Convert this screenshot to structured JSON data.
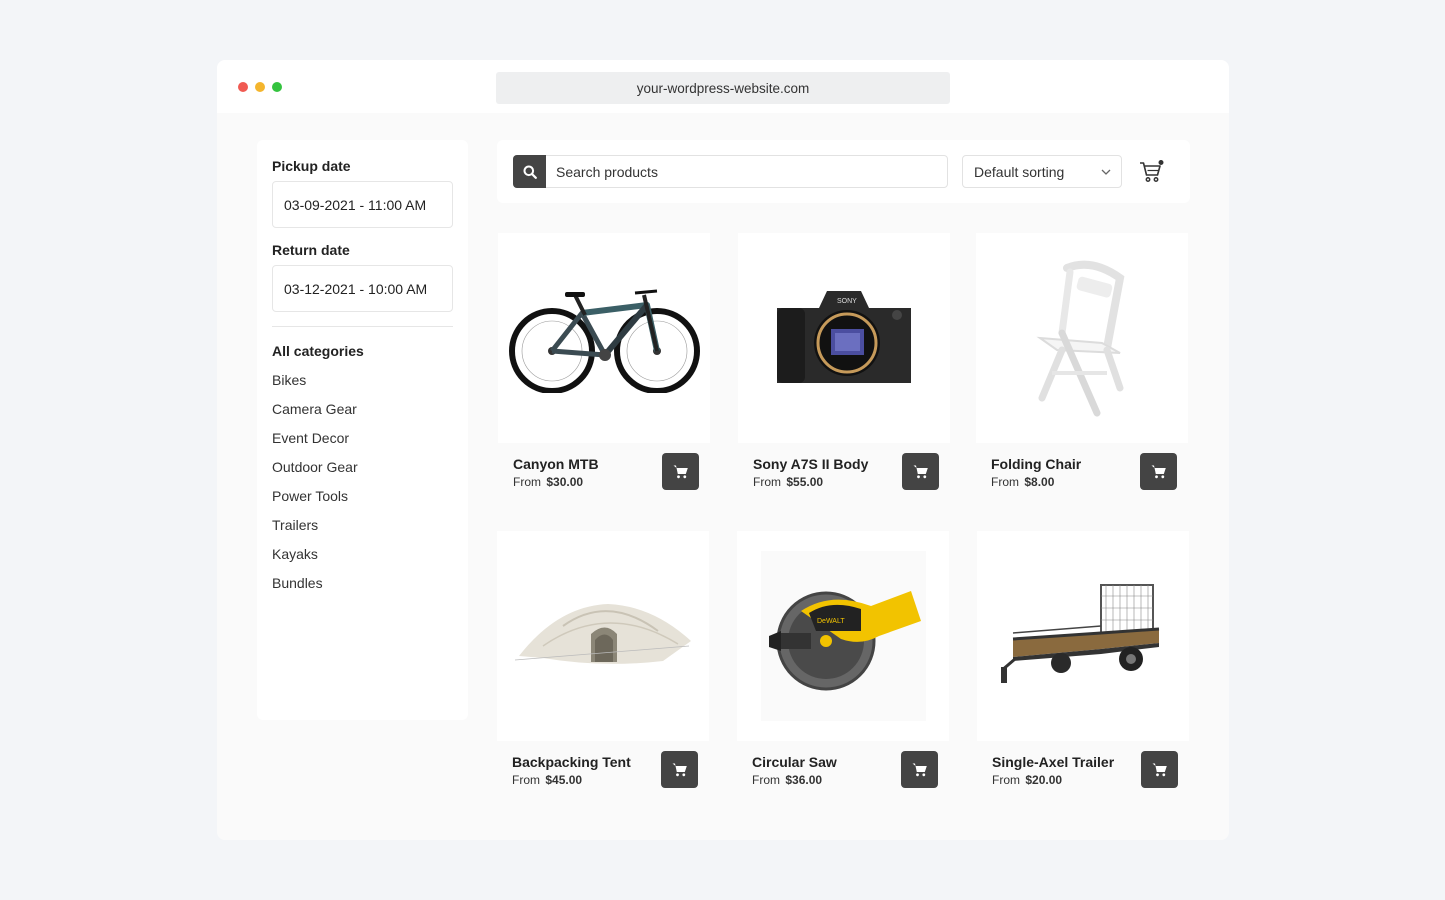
{
  "browser": {
    "url": "your-wordpress-website.com"
  },
  "sidebar": {
    "pickup_label": "Pickup date",
    "pickup_value": "03-09-2021 - 11:00 AM",
    "return_label": "Return date",
    "return_value": "03-12-2021 - 10:00 AM",
    "categories_heading": "All categories",
    "categories": [
      "Bikes",
      "Camera Gear",
      "Event Decor",
      "Outdoor Gear",
      "Power Tools",
      "Trailers",
      "Kayaks",
      "Bundles"
    ]
  },
  "toolbar": {
    "search_value": "Search products",
    "sort_value": "Default sorting"
  },
  "products": [
    {
      "name": "Canyon MTB",
      "from": "From",
      "price": "$30.00",
      "icon": "bike-image"
    },
    {
      "name": "Sony A7S II Body",
      "from": "From",
      "price": "$55.00",
      "icon": "camera-image"
    },
    {
      "name": "Folding Chair",
      "from": "From",
      "price": "$8.00",
      "icon": "chair-image"
    },
    {
      "name": "Backpacking Tent",
      "from": "From",
      "price": "$45.00",
      "icon": "tent-image"
    },
    {
      "name": "Circular Saw",
      "from": "From",
      "price": "$36.00",
      "icon": "saw-image"
    },
    {
      "name": "Single-Axel Trailer",
      "from": "From",
      "price": "$20.00",
      "icon": "trailer-image"
    }
  ],
  "colors": {
    "button_dark": "#444444",
    "traffic_red": "#f05a52",
    "traffic_yellow": "#f4b52d",
    "traffic_green": "#34c33f"
  }
}
